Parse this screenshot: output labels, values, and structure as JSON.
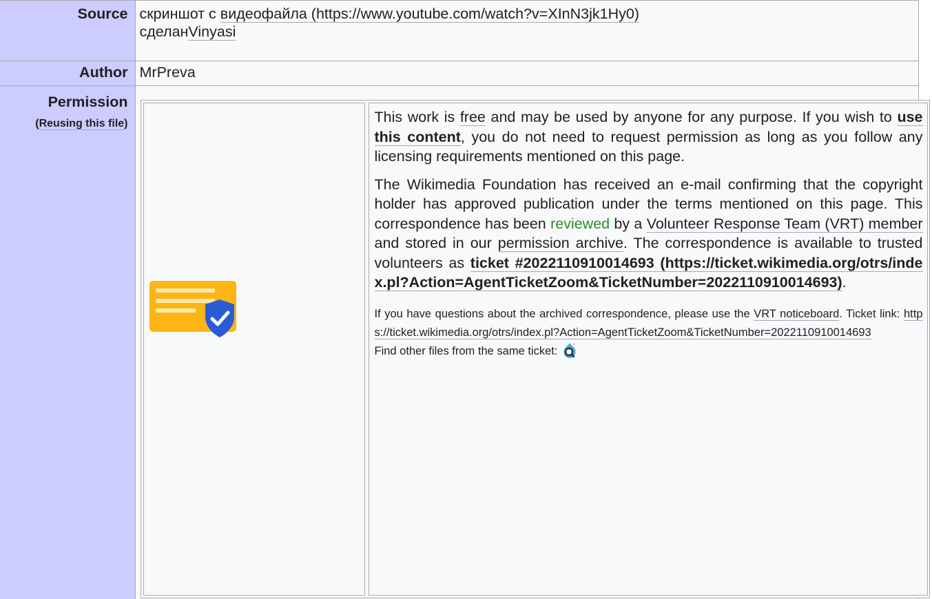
{
  "source": {
    "label": "Source",
    "text_prefix": "скриншот с ",
    "link_text": "видеофайла (https://www.youtube.com/watch?v=XInN3jk1Hy0)",
    "made_by_text": "сделан",
    "made_by_link": "Vinyasi"
  },
  "author": {
    "label": "Author",
    "value": "MrPreva"
  },
  "permission": {
    "label": "Permission",
    "sub_open": "(",
    "sub_link": "Reusing this file",
    "sub_close": ")",
    "icon": "vrt-permission-shield-icon",
    "p1": {
      "t1": "This work is ",
      "free_link": "free",
      "t2": " and may be used by anyone for any purpose. If you wish to ",
      "use_link": "use this content",
      "t3": ", you do not need to request permission as long as you follow any licensing requirements mentioned on this page."
    },
    "p2": {
      "t1": "The Wikimedia Foundation has received an e-mail confirming that the copyright holder has approved publication under the terms mentioned on this page. This correspondence has been ",
      "reviewed_link": "reviewed",
      "t2": " by a ",
      "vrt_link": "Volunteer Response Team (VRT) member",
      "t3": " and stored in our ",
      "archive_link": "permission archive",
      "t4": ". The correspondence is available to trusted volunteers as ",
      "ticket_link": "ticket #2022110910014693 (https://ticket.wikimedia.org/otrs/index.pl?Action=AgentTicketZoom&TicketNumber=2022110910014693)",
      "t5": "."
    },
    "p3": {
      "t1": "If you have questions about the archived correspondence, please use the ",
      "noticeboard_link": "VRT noticeboard",
      "t2": ". Ticket link: ",
      "ticket_url_link": "https://ticket.wikimedia.org/otrs/index.pl?Action=AgentTicketZoom&TicketNumber=2022110910014693"
    },
    "p4": {
      "text": "Find other files from the same ticket: ",
      "icon": "magnifier-search-icon"
    }
  },
  "colors": {
    "header_bg": "#ccccff",
    "cell_bg": "#f9f9f9",
    "reviewed_link": "#2e8b2e",
    "icon_orange": "#fdb515",
    "icon_blue": "#2a5bd7"
  }
}
